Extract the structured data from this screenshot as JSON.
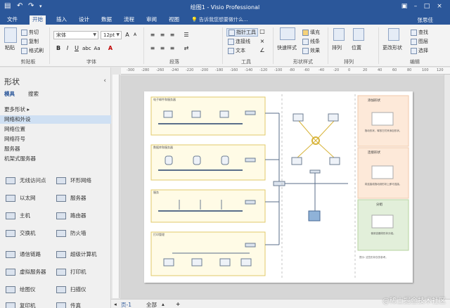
{
  "app": {
    "title": "绘图1 - Visio Professional",
    "user": "张思佳",
    "tell_me": "告诉我您想要做什么..."
  },
  "tabs": [
    "文件",
    "开始",
    "插入",
    "设计",
    "数据",
    "流程",
    "审阅",
    "视图"
  ],
  "ribbon": {
    "clipboard": {
      "paste": "粘贴",
      "cut": "剪切",
      "copy": "复制",
      "format_painter": "格式刷",
      "label": "剪贴板"
    },
    "font": {
      "family": "宋体",
      "size": "12pt",
      "label": "字体"
    },
    "paragraph": {
      "label": "段落"
    },
    "tools": {
      "pointer": "指针工具",
      "connector": "连接线",
      "text": "文本",
      "label": "工具"
    },
    "shape_styles": {
      "quick_styles": "快速样式",
      "fill": "填充",
      "line": "线条",
      "effects": "效果",
      "label": "形状样式"
    },
    "arrange": {
      "arrange": "排列",
      "position": "位置",
      "label": "排列"
    },
    "editing": {
      "change_shape": "更改形状",
      "find": "查找",
      "layers": "图层",
      "select": "选择",
      "label": "编辑"
    }
  },
  "shapes_panel": {
    "title": "形状",
    "tabs": [
      "模具",
      "搜索"
    ],
    "more_shapes": "更多形状",
    "stencils": [
      "网络和外设",
      "网络位置",
      "网络符号",
      "服务器",
      "机架式服务器"
    ],
    "selected_stencil": "网络和外设",
    "items": [
      [
        "无线访问点",
        "环形网络"
      ],
      [
        "以太网",
        "服务器"
      ],
      [
        "主机",
        "路由器"
      ],
      [
        "交换机",
        "防火墙"
      ],
      [
        "通信链路",
        "超级计算机"
      ],
      [
        "虚拟服务器",
        "打印机"
      ],
      [
        "绘图仪",
        "扫描仪"
      ],
      [
        "复印机",
        "传真"
      ]
    ]
  },
  "ruler_ticks": [
    "-300",
    "-280",
    "-260",
    "-240",
    "-220",
    "-200",
    "-180",
    "-160",
    "-140",
    "-120",
    "-100",
    "-80",
    "-60",
    "-40",
    "-20",
    "0",
    "20",
    "40",
    "60",
    "80",
    "100",
    "120"
  ],
  "diagram": {
    "sections": [
      "电子邮件和服务器",
      "数据库和服务器",
      "服务",
      "打印管理"
    ],
    "tips": [
      {
        "title": "添加形状",
        "text": "拖动形状，释放它们来添加形状。"
      },
      {
        "title": "连接形状",
        "text": "将连接线拖动到形状上即可连接。"
      },
      {
        "title": "分组",
        "text": "使用容器将形状分组。"
      }
    ],
    "footer_note": "提示: 这些形状仅供参考。"
  },
  "status": {
    "page_tab": "页-1",
    "all": "全部",
    "add": "+"
  },
  "watermark": "@稀土掘金技术社区",
  "colors": {
    "ribbon_blue": "#2b579a",
    "container_yellow": "#fffbe6",
    "container_border": "#e0c96a",
    "tip_orange": "#fde9d9",
    "tip_green": "#e2efda"
  }
}
